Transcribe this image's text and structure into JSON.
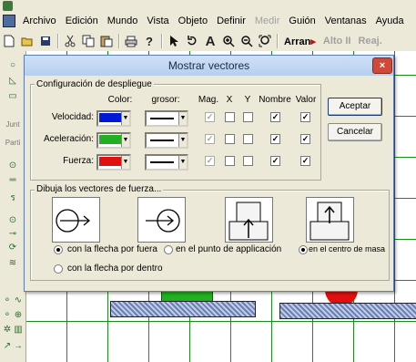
{
  "menubar": {
    "items": [
      "Archivo",
      "Edición",
      "Mundo",
      "Vista",
      "Objeto",
      "Definir",
      "Medir",
      "Guión",
      "Ventanas",
      "Ayuda"
    ],
    "disabled_item": "Medir"
  },
  "toolbar": {
    "icons": [
      "new-document-icon",
      "open-folder-icon",
      "save-icon",
      "cut-icon",
      "copy-icon",
      "paste-icon",
      "print-icon",
      "help-icon",
      "pointer-icon",
      "rotate-icon",
      "text-icon",
      "zoom-in-icon",
      "zoom-out-icon",
      "zoom-fit-icon"
    ],
    "zoom_glyphs": {
      "text": "A"
    },
    "run_label": "Arran",
    "pause_label": "Alto",
    "reset_label": "Reaj."
  },
  "palette": {
    "side_labels": [
      "Junt",
      "Parti"
    ]
  },
  "dialog": {
    "title": "Mostrar vectores",
    "close": "×",
    "display_group": {
      "label": "Configuración de despliegue",
      "headers": {
        "color": "Color:",
        "weight": "grosor:",
        "mag": "Mag.",
        "x": "X",
        "y": "Y",
        "name": "Nombre",
        "value": "Valor"
      },
      "rows": [
        {
          "label": "Velocidad:",
          "color": "#0018d8",
          "mag": true,
          "mag_disabled": true,
          "x": false,
          "y": false,
          "name": true,
          "value": true
        },
        {
          "label": "Aceleración:",
          "color": "#20b020",
          "mag": true,
          "mag_disabled": true,
          "x": false,
          "y": false,
          "name": true,
          "value": true
        },
        {
          "label": "Fuerza:",
          "color": "#e01010",
          "mag": true,
          "mag_disabled": true,
          "x": false,
          "y": false,
          "name": true,
          "value": true
        }
      ]
    },
    "accept_label": "Aceptar",
    "cancel_label": "Cancelar",
    "force_group": {
      "label": "Dibuja los vectores de fuerza...",
      "options": [
        {
          "label": "con la flecha por fuera",
          "selected": true
        },
        {
          "label": "con la flecha por dentro",
          "selected": false
        },
        {
          "label": "en el punto de applicación",
          "selected": false
        },
        {
          "label": "en el centro de masa",
          "selected": true
        }
      ]
    }
  }
}
